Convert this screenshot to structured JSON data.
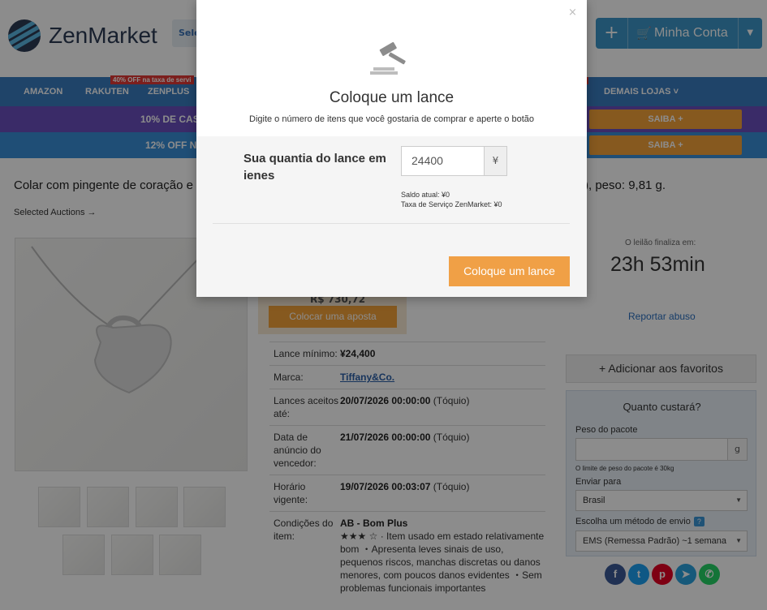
{
  "header": {
    "logo_text": "ZenMarket",
    "select_stub": "Sele",
    "account_label": "Minha Conta"
  },
  "nav": {
    "items": [
      "AMAZON",
      "RAKUTEN",
      "ZENPLUS",
      "DEMAIS LOJAS"
    ],
    "badge": "40% OFF na taxa de servi"
  },
  "promos": [
    {
      "text": "10% DE CAS",
      "button": "SAIBA +"
    },
    {
      "text": "12% OFF N",
      "button": "SAIBA +"
    }
  ],
  "product": {
    "title_left": "Colar com pingente de coração e",
    "title_right": "), peso: 9,81 g.",
    "breadcrumb": "Selected Auctions →",
    "partial_price": "R$ 730,72",
    "bid_button": "Colocar uma aposta"
  },
  "info_rows": [
    {
      "key": "Lance mínimo:",
      "value_bold": "¥24,400",
      "value_rest": ""
    },
    {
      "key": "Marca:",
      "value_bold": "Tiffany&Co.",
      "value_rest": ""
    },
    {
      "key": "Lances aceitos até:",
      "value_bold": "20/07/2026 00:00:00",
      "value_rest": " (Tóquio)"
    },
    {
      "key": "Data de anúncio do vencedor:",
      "value_bold": "21/07/2026 00:00:00",
      "value_rest": " (Tóquio)"
    },
    {
      "key": "Horário vigente:",
      "value_bold": "19/07/2026 00:03:07",
      "value_rest": " (Tóquio)"
    },
    {
      "key": "Condições do item:",
      "value_bold": "AB - Bom Plus",
      "value_rest": "★★★ ☆ · Item usado em estado relativamente bom ・Apresenta leves sinais de uso, pequenos riscos, manchas discretas ou danos menores, com poucos danos evidentes ・Sem problemas funcionais importantes"
    }
  ],
  "sidebar": {
    "ends_label": "O leilão finaliza em:",
    "timer": "23h 53min",
    "report": "Reportar abuso",
    "favorite": "+ Adicionar aos favoritos",
    "calc_title": "Quanto custará?",
    "weight_label": "Peso do pacote",
    "weight_unit": "g",
    "weight_note": "O limite de peso do pacote é 30kg",
    "ship_to_label": "Enviar para",
    "ship_to_value": "Brasil",
    "method_label": "Escolha um método de envio",
    "method_value": "EMS (Remessa Padrão) ~1 semana"
  },
  "modal": {
    "close": "×",
    "title": "Coloque um lance",
    "subtitle": "Digite o número de itens que você gostaria de comprar e aperte o botão",
    "field_label": "Sua quantia do lance em ienes",
    "bid_value": "24400",
    "currency": "¥",
    "balance": "Saldo atual: ¥0",
    "service_fee": "Taxa de Serviço ZenMarket: ¥0",
    "submit": "Coloque um lance"
  },
  "colors": {
    "accent_orange": "#f0a046",
    "nav_blue": "#3a7cc0",
    "promo_purple": "#6a4fbe",
    "link_blue": "#2a6fbf"
  }
}
